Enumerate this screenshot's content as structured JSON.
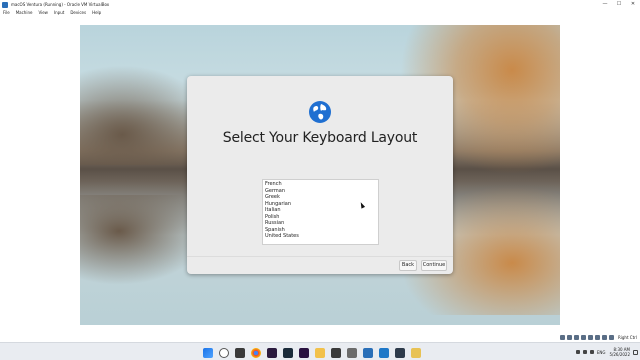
{
  "window": {
    "title": "macOS Ventura (Running) - Oracle VM VirtualBox",
    "controls": [
      "—",
      "☐",
      "✕"
    ]
  },
  "menubar": {
    "items": [
      "File",
      "Machine",
      "View",
      "Input",
      "Devices",
      "Help"
    ]
  },
  "installer": {
    "title": "Select Your Keyboard Layout",
    "layouts": [
      "French",
      "German",
      "Greek",
      "Hungarian",
      "Italian",
      "Polish",
      "Russian",
      "Spanish",
      "United States"
    ],
    "back_label": "Back",
    "continue_label": "Continue"
  },
  "statusbar": {
    "host_key": "Right Ctrl"
  },
  "taskbar": {
    "icons": [
      "windows-start-icon",
      "search-icon",
      "task-view-icon",
      "chrome-icon",
      "ps-icon",
      "media-encoder-icon",
      "premiere-icon",
      "file-explorer-icon",
      "edge-icon",
      "powershell-icon",
      "virtualbox-icon",
      "vscode-icon",
      "settings-icon",
      "folder-icon"
    ],
    "language": "ENG",
    "time": "8:30 AM",
    "date": "5/26/2022"
  },
  "colors": {
    "accent_globe": "#1f6fd1",
    "taskbar_bg": "#e9ecf1",
    "dialog_bg": "#ebebeb"
  }
}
